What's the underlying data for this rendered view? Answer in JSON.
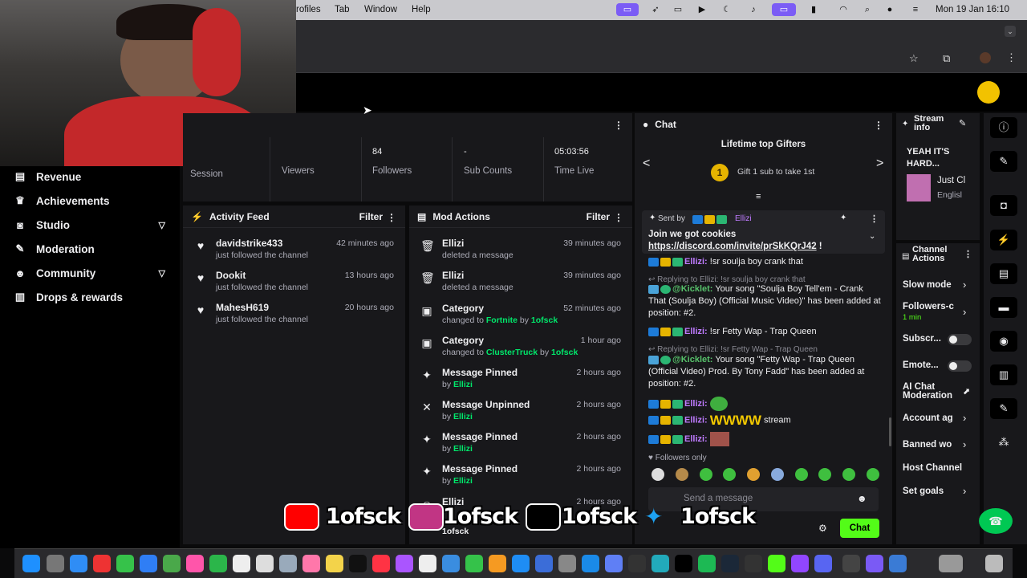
{
  "menubar": {
    "items": [
      "rofiles",
      "Tab",
      "Window",
      "Help"
    ],
    "datetime": "Mon 19 Jan  16:10"
  },
  "nav": {
    "items": [
      {
        "label": "Revenue",
        "icon": "dollar-icon",
        "chevron": false
      },
      {
        "label": "Achievements",
        "icon": "trophy-icon",
        "chevron": false
      },
      {
        "label": "Studio",
        "icon": "camera-icon",
        "chevron": true
      },
      {
        "label": "Moderation",
        "icon": "wrench-icon",
        "chevron": false
      },
      {
        "label": "Community",
        "icon": "people-icon",
        "chevron": true
      },
      {
        "label": "Drops & rewards",
        "icon": "gift-icon",
        "chevron": false
      }
    ]
  },
  "stats": {
    "session_label": "Session",
    "viewers_label": "Viewers",
    "followers_value": "84",
    "followers_label": "Followers",
    "subs_value": "-",
    "subs_label": "Sub Counts",
    "time_value": "05:03:56",
    "time_label": "Time Live"
  },
  "activity": {
    "title": "Activity Feed",
    "filter": "Filter",
    "rows": [
      {
        "name": "davidstrike433",
        "sub": "just followed the channel",
        "time": "42 minutes ago"
      },
      {
        "name": "Dookit",
        "sub": "just followed the channel",
        "time": "13 hours ago"
      },
      {
        "name": "MahesH619",
        "sub": "just followed the channel",
        "time": "20 hours ago"
      }
    ]
  },
  "mod": {
    "title": "Mod Actions",
    "filter": "Filter",
    "rows": [
      {
        "icon": "trash-icon",
        "title": "Ellizi",
        "sub": "deleted a message",
        "time": "39 minutes ago"
      },
      {
        "icon": "trash-icon",
        "title": "Ellizi",
        "sub": "deleted a message",
        "time": "39 minutes ago"
      },
      {
        "icon": "category-icon",
        "title": "Category",
        "pre": "changed to ",
        "hl": "Fortnite",
        "mid": " by ",
        "by": "1ofsck",
        "time": "52 minutes ago"
      },
      {
        "icon": "category-icon",
        "title": "Category",
        "pre": "changed to ",
        "hl": "ClusterTruck",
        "mid": " by ",
        "by": "1ofsck",
        "time": "1 hour ago"
      },
      {
        "icon": "pin-icon",
        "title": "Message Pinned",
        "pre": "by ",
        "by": "Ellizi",
        "time": "2 hours ago"
      },
      {
        "icon": "unpin-icon",
        "title": "Message Unpinned",
        "pre": "by ",
        "by": "Ellizi",
        "time": "2 hours ago"
      },
      {
        "icon": "pin-icon",
        "title": "Message Pinned",
        "pre": "by ",
        "by": "Ellizi",
        "time": "2 hours ago"
      },
      {
        "icon": "pin-icon",
        "title": "Message Pinned",
        "pre": "by ",
        "by": "Ellizi",
        "time": "2 hours ago"
      },
      {
        "icon": "user-icon",
        "title": "Ellizi",
        "pre": "",
        "by": "1ofsck",
        "time": "2 hours ago"
      }
    ]
  },
  "chat": {
    "title": "Chat",
    "gifters_title": "Lifetime top Gifters",
    "gift_rank": "1",
    "gift_cta": "Gift 1 sub to take 1st",
    "pinned_by": "Sent by",
    "pinned_user": "Ellizi",
    "pinned_msg": "Join we got cookies",
    "pinned_link": "https://discord.com/invite/prSkKQrJ42",
    "pinned_end": " !",
    "lines": [
      {
        "user": "Ellizi:",
        "text": " !sr soulja boy crank that"
      },
      {
        "reply": "Replying to Ellizi: !sr soulja boy crank that"
      },
      {
        "bot": "@Kicklet:",
        "text": " Your song \"Soulja Boy Tell'em - Crank That (Soulja Boy) (Official Music Video)\" has been added at position: #2."
      },
      {
        "user": "Ellizi:",
        "text": " !sr Fetty Wap - Trap Queen"
      },
      {
        "reply": "Replying to Ellizi: !sr Fetty Wap - Trap Queen"
      },
      {
        "bot": "@Kicklet:",
        "text": " Your song \"Fetty Wap - Trap Queen (Official Video) Prod. By Tony Fadd\" has been added at position: #2."
      },
      {
        "user": "Ellizi:",
        "text": ""
      },
      {
        "user": "Ellizi:",
        "text": "WWWW",
        "tail": " stream"
      },
      {
        "user": "Ellizi:",
        "text": ""
      }
    ],
    "followers_only": "Followers only",
    "placeholder": "Send a message",
    "send": "Chat"
  },
  "streaminfo": {
    "title": "Stream info",
    "stream_title": "YEAH IT'S HARD...",
    "category": "Just Cl",
    "language": "Englisl"
  },
  "channel": {
    "title": "Channel Actions",
    "slow": "Slow mode",
    "followers": "Followers-c",
    "followers_sub": "1 min",
    "subs": "Subscr...",
    "emotes": "Emote...",
    "ai": "AI Chat Moderation",
    "account": "Account ag",
    "banned": "Banned wo",
    "host": "Host Channel",
    "goals": "Set goals"
  },
  "overlay": {
    "handle": "1ofsck"
  },
  "colors": {
    "accent": "#53fc18",
    "panel": "#18181b",
    "badge_blue": "#1d7bd8",
    "badge_gold": "#e6b400",
    "badge_green": "#2bb673",
    "user": "#bf7bff"
  }
}
